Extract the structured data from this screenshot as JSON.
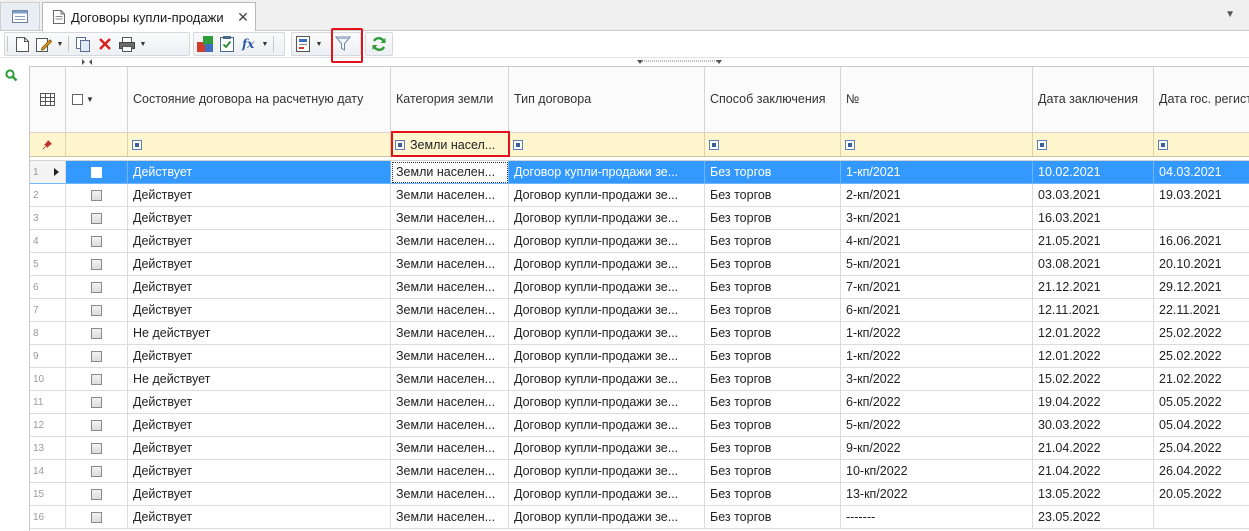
{
  "tabs": {
    "active_label": "Договоры купли-продажи"
  },
  "columns": [
    {
      "key": "state",
      "label": "Состояние договора на расчетную дату"
    },
    {
      "key": "category",
      "label": "Категория земли"
    },
    {
      "key": "type",
      "label": "Тип договора"
    },
    {
      "key": "method",
      "label": "Способ заключения"
    },
    {
      "key": "number",
      "label": "№"
    },
    {
      "key": "date_concluded",
      "label": "Дата заключения"
    },
    {
      "key": "date_registered",
      "label": "Дата гос. регистрации"
    }
  ],
  "filter": {
    "category_value": "Земли насел..."
  },
  "rows": [
    {
      "n": "1",
      "state": "Действует",
      "category": "Земли населен...",
      "type": "Договор купли-продажи зе...",
      "method": "Без торгов",
      "number": "1-кп/2021",
      "date_concluded": "10.02.2021",
      "date_registered": "04.03.2021"
    },
    {
      "n": "2",
      "state": "Действует",
      "category": "Земли населен...",
      "type": "Договор купли-продажи зе...",
      "method": "Без торгов",
      "number": "2-кп/2021",
      "date_concluded": "03.03.2021",
      "date_registered": "19.03.2021"
    },
    {
      "n": "3",
      "state": "Действует",
      "category": "Земли населен...",
      "type": "Договор купли-продажи зе...",
      "method": "Без торгов",
      "number": "3-кп/2021",
      "date_concluded": "16.03.2021",
      "date_registered": ""
    },
    {
      "n": "4",
      "state": "Действует",
      "category": "Земли населен...",
      "type": "Договор купли-продажи зе...",
      "method": "Без торгов",
      "number": "4-кп/2021",
      "date_concluded": "21.05.2021",
      "date_registered": "16.06.2021"
    },
    {
      "n": "5",
      "state": "Действует",
      "category": "Земли населен...",
      "type": "Договор купли-продажи зе...",
      "method": "Без торгов",
      "number": "5-кп/2021",
      "date_concluded": "03.08.2021",
      "date_registered": "20.10.2021"
    },
    {
      "n": "6",
      "state": "Действует",
      "category": "Земли населен...",
      "type": "Договор купли-продажи зе...",
      "method": "Без торгов",
      "number": "7-кп/2021",
      "date_concluded": "21.12.2021",
      "date_registered": "29.12.2021"
    },
    {
      "n": "7",
      "state": "Действует",
      "category": "Земли населен...",
      "type": "Договор купли-продажи зе...",
      "method": "Без торгов",
      "number": "6-кп/2021",
      "date_concluded": "12.11.2021",
      "date_registered": "22.11.2021"
    },
    {
      "n": "8",
      "state": "Не действует",
      "category": "Земли населен...",
      "type": "Договор купли-продажи зе...",
      "method": "Без торгов",
      "number": "1-кп/2022",
      "date_concluded": "12.01.2022",
      "date_registered": "25.02.2022"
    },
    {
      "n": "9",
      "state": "Действует",
      "category": "Земли населен...",
      "type": "Договор купли-продажи зе...",
      "method": "Без торгов",
      "number": "1-кп/2022",
      "date_concluded": "12.01.2022",
      "date_registered": "25.02.2022"
    },
    {
      "n": "10",
      "state": "Не действует",
      "category": "Земли населен...",
      "type": "Договор купли-продажи зе...",
      "method": "Без торгов",
      "number": "3-кп/2022",
      "date_concluded": "15.02.2022",
      "date_registered": "21.02.2022"
    },
    {
      "n": "11",
      "state": "Действует",
      "category": "Земли населен...",
      "type": "Договор купли-продажи зе...",
      "method": "Без торгов",
      "number": "6-кп/2022",
      "date_concluded": "19.04.2022",
      "date_registered": "05.05.2022"
    },
    {
      "n": "12",
      "state": "Действует",
      "category": "Земли населен...",
      "type": "Договор купли-продажи зе...",
      "method": "Без торгов",
      "number": "5-кп/2022",
      "date_concluded": "30.03.2022",
      "date_registered": "05.04.2022"
    },
    {
      "n": "13",
      "state": "Действует",
      "category": "Земли населен...",
      "type": "Договор купли-продажи зе...",
      "method": "Без торгов",
      "number": "9-кп/2022",
      "date_concluded": "21.04.2022",
      "date_registered": "25.04.2022"
    },
    {
      "n": "14",
      "state": "Действует",
      "category": "Земли населен...",
      "type": "Договор купли-продажи зе...",
      "method": "Без торгов",
      "number": "10-кп/2022",
      "date_concluded": "21.04.2022",
      "date_registered": "26.04.2022"
    },
    {
      "n": "15",
      "state": "Действует",
      "category": "Земли населен...",
      "type": "Договор купли-продажи зе...",
      "method": "Без торгов",
      "number": "13-кп/2022",
      "date_concluded": "13.05.2022",
      "date_registered": "20.05.2022"
    },
    {
      "n": "16",
      "state": "Действует",
      "category": "Земли населен...",
      "type": "Договор купли-продажи зе...",
      "method": "Без торгов",
      "number": "-------",
      "date_concluded": "23.05.2022",
      "date_registered": ""
    }
  ],
  "selected_row_index": 0,
  "colors": {
    "selection": "#3399ff",
    "filter_row": "#fff6cf",
    "highlight_box": "#e2121a"
  }
}
